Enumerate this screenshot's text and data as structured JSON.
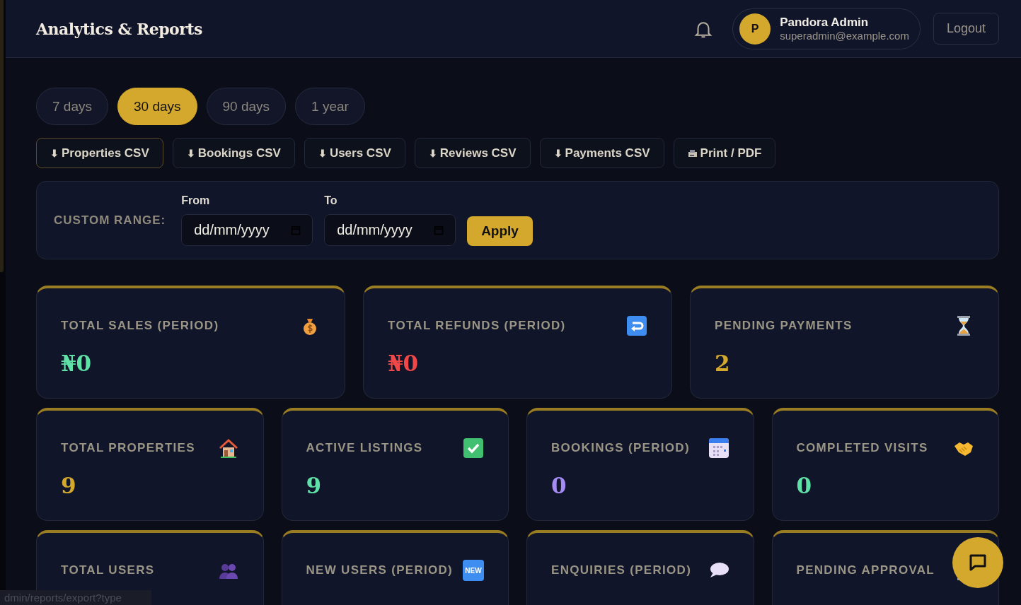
{
  "header": {
    "title": "Analytics & Reports",
    "user": {
      "initial": "P",
      "name": "Pandora Admin",
      "email": "superadmin@example.com"
    },
    "logout": "Logout"
  },
  "periods": [
    {
      "label": "7 days",
      "selected": false
    },
    {
      "label": "30 days",
      "selected": true
    },
    {
      "label": "90 days",
      "selected": false
    },
    {
      "label": "1 year",
      "selected": false
    }
  ],
  "exports": [
    {
      "glyph": "⬇",
      "label": "Properties CSV",
      "focused": true
    },
    {
      "glyph": "⬇",
      "label": "Bookings CSV",
      "focused": false
    },
    {
      "glyph": "⬇",
      "label": "Users CSV",
      "focused": false
    },
    {
      "glyph": "⬇",
      "label": "Reviews CSV",
      "focused": false
    },
    {
      "glyph": "⬇",
      "label": "Payments CSV",
      "focused": false
    },
    {
      "label": "Print / PDF",
      "focused": false
    }
  ],
  "custom_range": {
    "label": "CUSTOM RANGE:",
    "from": {
      "label": "From",
      "placeholder": "dd/mm/yyyy"
    },
    "to": {
      "label": "To",
      "placeholder": "dd/mm/yyyy"
    },
    "apply": "Apply"
  },
  "stat_rows": [
    {
      "cards": [
        {
          "label": "TOTAL SALES (PERIOD)",
          "value": "₦0",
          "color": "#5fe0a6"
        },
        {
          "label": "TOTAL REFUNDS (PERIOD)",
          "value": "₦0",
          "color": "#f04848"
        },
        {
          "label": "PENDING PAYMENTS",
          "value": "2",
          "color": "#d4a82c"
        }
      ]
    },
    {
      "cards": [
        {
          "label": "TOTAL PROPERTIES",
          "value": "9",
          "color": "#d4a82c"
        },
        {
          "label": "ACTIVE LISTINGS",
          "value": "9",
          "color": "#5fe0a6"
        },
        {
          "label": "BOOKINGS (PERIOD)",
          "value": "0",
          "color": "#a58cf5"
        },
        {
          "label": "COMPLETED VISITS",
          "value": "0",
          "color": "#5fe0a6"
        }
      ]
    },
    {
      "cards": [
        {
          "label": "TOTAL USERS"
        },
        {
          "label": "NEW USERS (PERIOD)",
          "badge": "NEW"
        },
        {
          "label": "ENQUIRIES (PERIOD)"
        },
        {
          "label": "PENDING APPROVAL"
        }
      ]
    }
  ],
  "status_url": "dmin/reports/export?type"
}
